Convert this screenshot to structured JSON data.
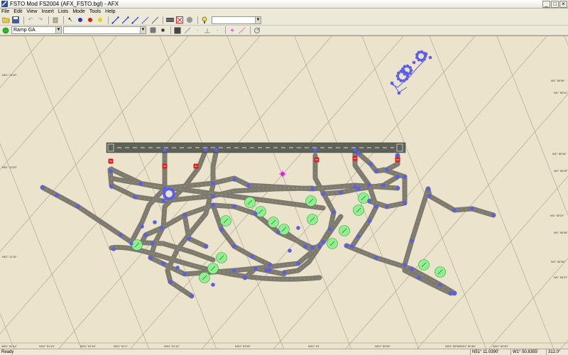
{
  "window": {
    "title": "FSTO Mod FS2004 (AFX_FSTO.bgl) - AFX",
    "controls": {
      "minimize": "_",
      "maximize": "□",
      "close": "×"
    }
  },
  "menu": [
    "File",
    "Edit",
    "View",
    "Insert",
    "Lists",
    "Mode",
    "Tools",
    "Help"
  ],
  "toolbar": {
    "layer_combo_value": "",
    "ramp_select_value": "Ramp GA",
    "name_combo_value": ""
  },
  "map": {
    "background_color": "#ece3cc",
    "taxiway_color": "#7d7a70",
    "runway_color": "#5f6357",
    "node_color": "#5a5ee8",
    "parking_color": "#8ff08f",
    "hold_color": "#d82020",
    "lat_labels_left": [
      "N51° 11'20\"",
      "N51° 11'20\"",
      "N51° 11'15\""
    ],
    "lat_labels_right": [
      "W1° 50'50\"",
      "W1° 50'11\"",
      "W1° 50'16\"",
      "W1° 50'40\"",
      "W1° 50'24\"",
      "W1° 50'48\"",
      "W1° 50'30\"",
      "W1° 50'47\""
    ],
    "lon_labels_bottom": [
      "W01° 51'14\"",
      "W01° 51'10\"",
      "W01° 51'16\"",
      "W01° 51'1\"",
      "W01° 51'12\"",
      "W01° 51'06\"",
      "W01° 51'",
      "W01° 50'54\"",
      "W01° 50'58\"",
      "W01° 50'46\"",
      "W01° 50'40\""
    ],
    "title_label": ""
  },
  "status": {
    "ready": "Ready",
    "lat": "N51° 11.0390'",
    "lon": "W1° 50.8355'",
    "heading": "312.0°"
  }
}
